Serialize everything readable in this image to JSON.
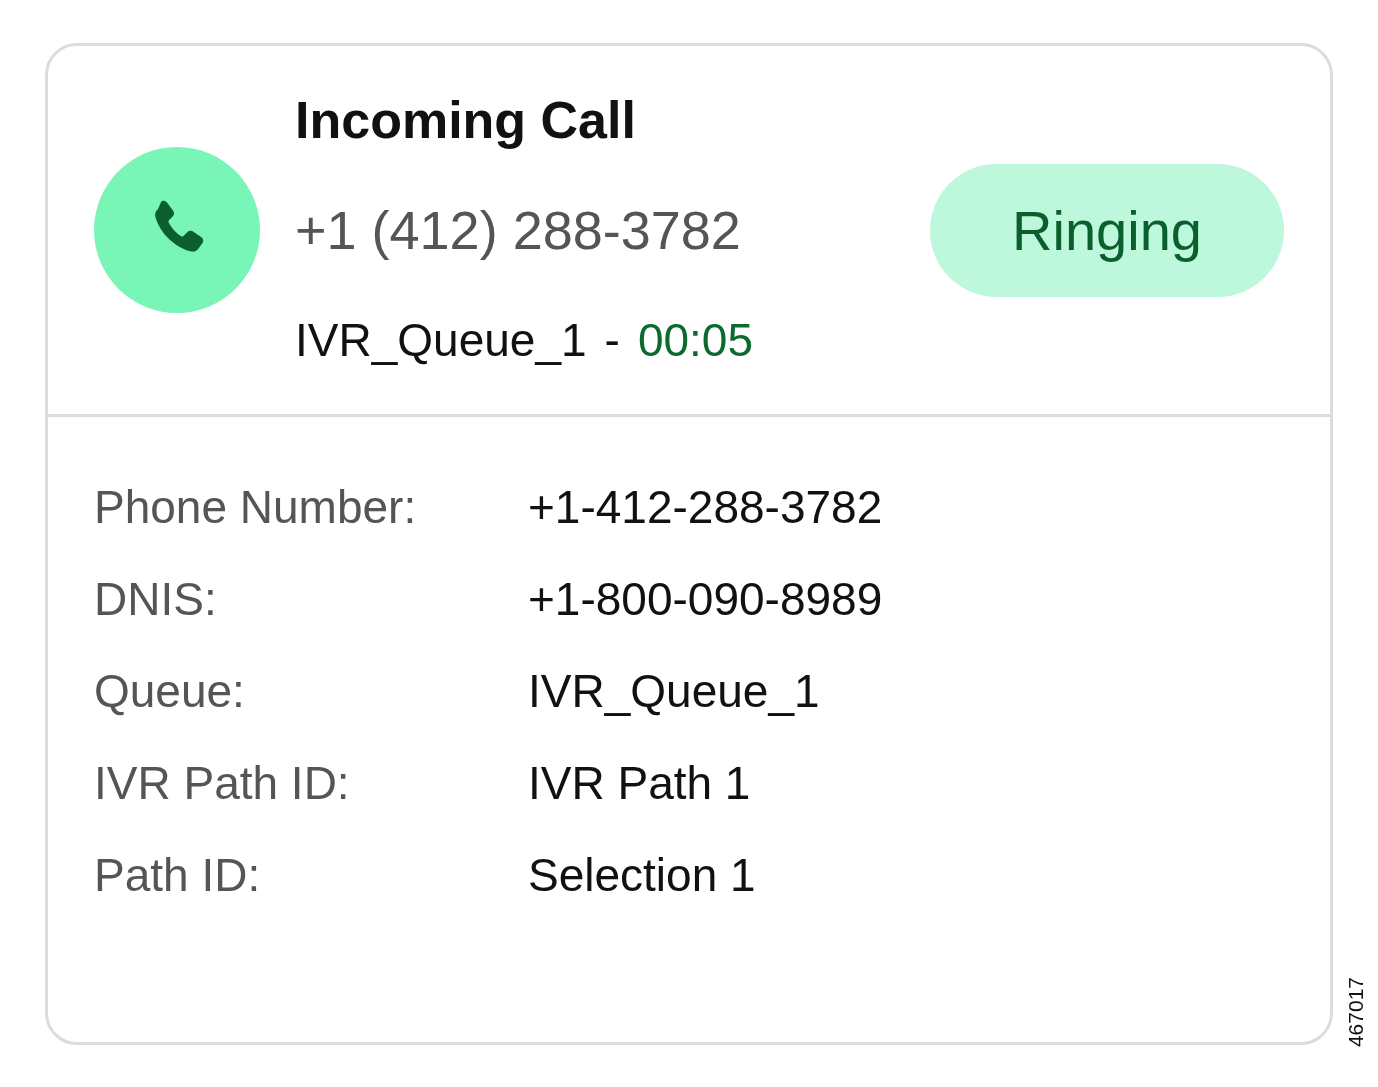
{
  "call": {
    "title": "Incoming Call",
    "caller": "+1 (412) 288-3782",
    "queue": "IVR_Queue_1",
    "separator": "-",
    "timer": "00:05",
    "status": {
      "label": "Ringing",
      "kind": "ringing"
    }
  },
  "details": [
    {
      "label": "Phone Number:",
      "value": "+1-412-288-3782"
    },
    {
      "label": "DNIS:",
      "value": "+1-800-090-8989"
    },
    {
      "label": "Queue:",
      "value": "IVR_Queue_1"
    },
    {
      "label": "IVR Path ID:",
      "value": "IVR Path 1"
    },
    {
      "label": "Path ID:",
      "value": "Selection 1"
    }
  ],
  "figure_id": "467017"
}
